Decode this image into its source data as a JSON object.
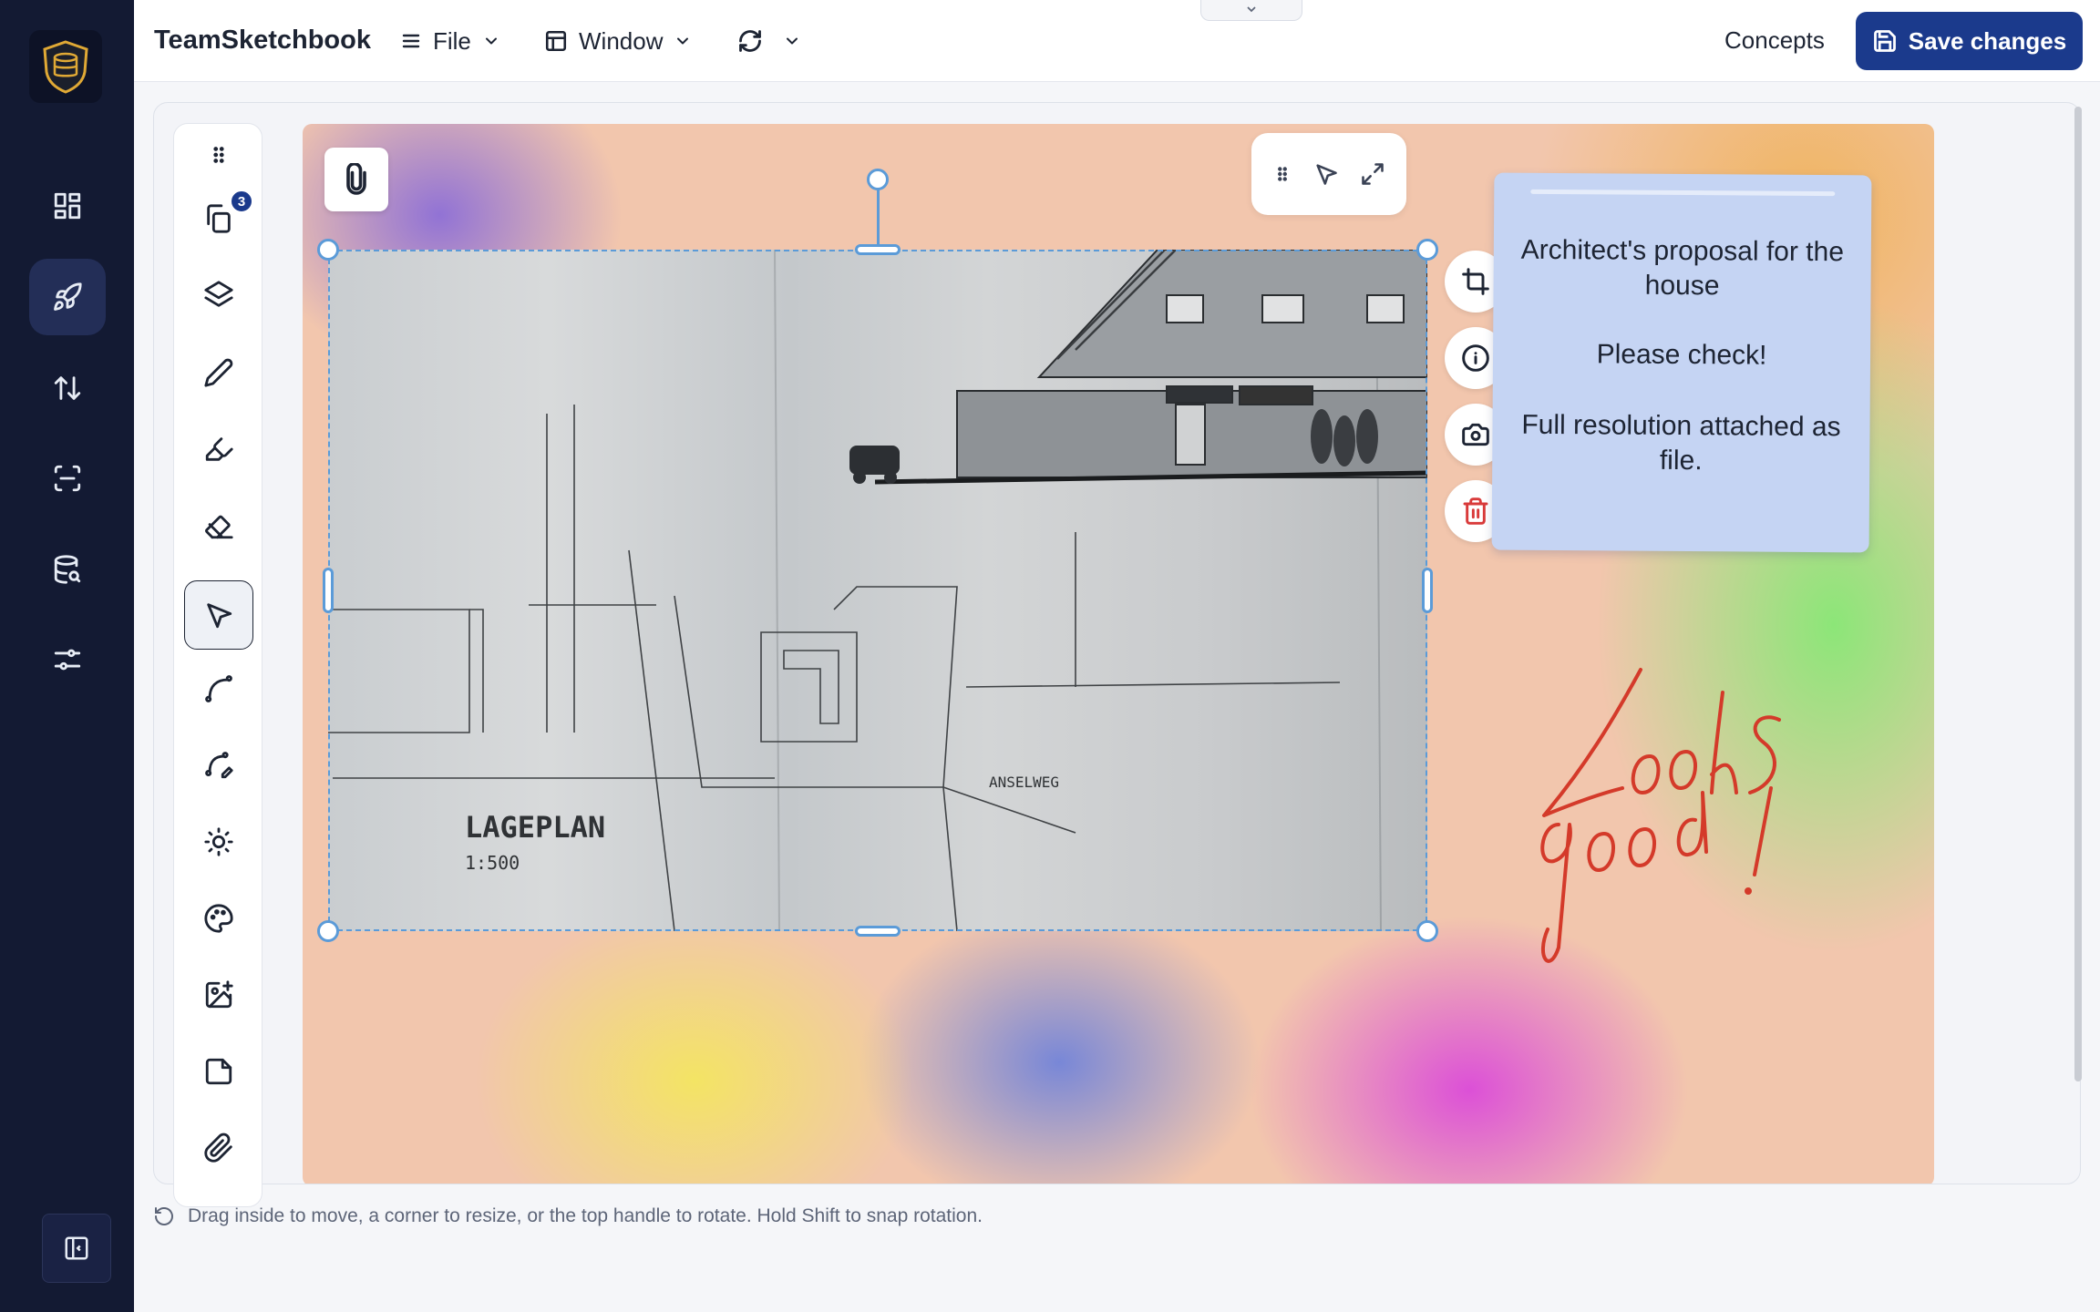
{
  "app": {
    "title": "TeamSketchbook"
  },
  "topbar": {
    "file_label": "File",
    "window_label": "Window",
    "concepts_label": "Concepts",
    "save_label": "Save changes"
  },
  "sidebar": {
    "items": [
      {
        "name": "dashboard",
        "icon": "dashboard-icon",
        "active": false
      },
      {
        "name": "rocket",
        "icon": "rocket-icon",
        "active": true
      },
      {
        "name": "sort",
        "icon": "arrows-up-down-icon",
        "active": false
      },
      {
        "name": "scan",
        "icon": "scan-icon",
        "active": false
      },
      {
        "name": "database-search",
        "icon": "database-search-icon",
        "active": false
      },
      {
        "name": "settings",
        "icon": "sliders-icon",
        "active": false
      }
    ],
    "collapse_icon": "sidebar-collapse-icon"
  },
  "toolbar": {
    "pages_count": "3",
    "tools": [
      "drag-handle-icon",
      "pages-icon",
      "layers-icon",
      "pencil-icon",
      "highlighter-icon",
      "eraser-icon",
      "select-pointer-icon",
      "curve-icon",
      "curve-edit-icon",
      "brightness-icon",
      "palette-icon",
      "add-image-icon",
      "note-icon",
      "paperclip-icon"
    ],
    "active_tool": "select-pointer-icon"
  },
  "note": {
    "line1": "Architect's proposal for the house",
    "line2": "Please check!",
    "line3": "Full resolution attached as file.",
    "color": "#c5d4f3"
  },
  "drawing": {
    "plan_title": "LAGEPLAN",
    "scale": "1:500",
    "street": "ANSELWEG"
  },
  "handwriting": {
    "text": "Looks good!",
    "color": "#d43a2a"
  },
  "hint": {
    "text": "Drag inside to move, a corner to resize, or the top handle to rotate. Hold Shift to snap rotation."
  },
  "colors": {
    "nav_bg": "#131a33",
    "accent": "#1b3a8c",
    "selection": "#5b9bd8",
    "danger": "#d93a3a"
  }
}
